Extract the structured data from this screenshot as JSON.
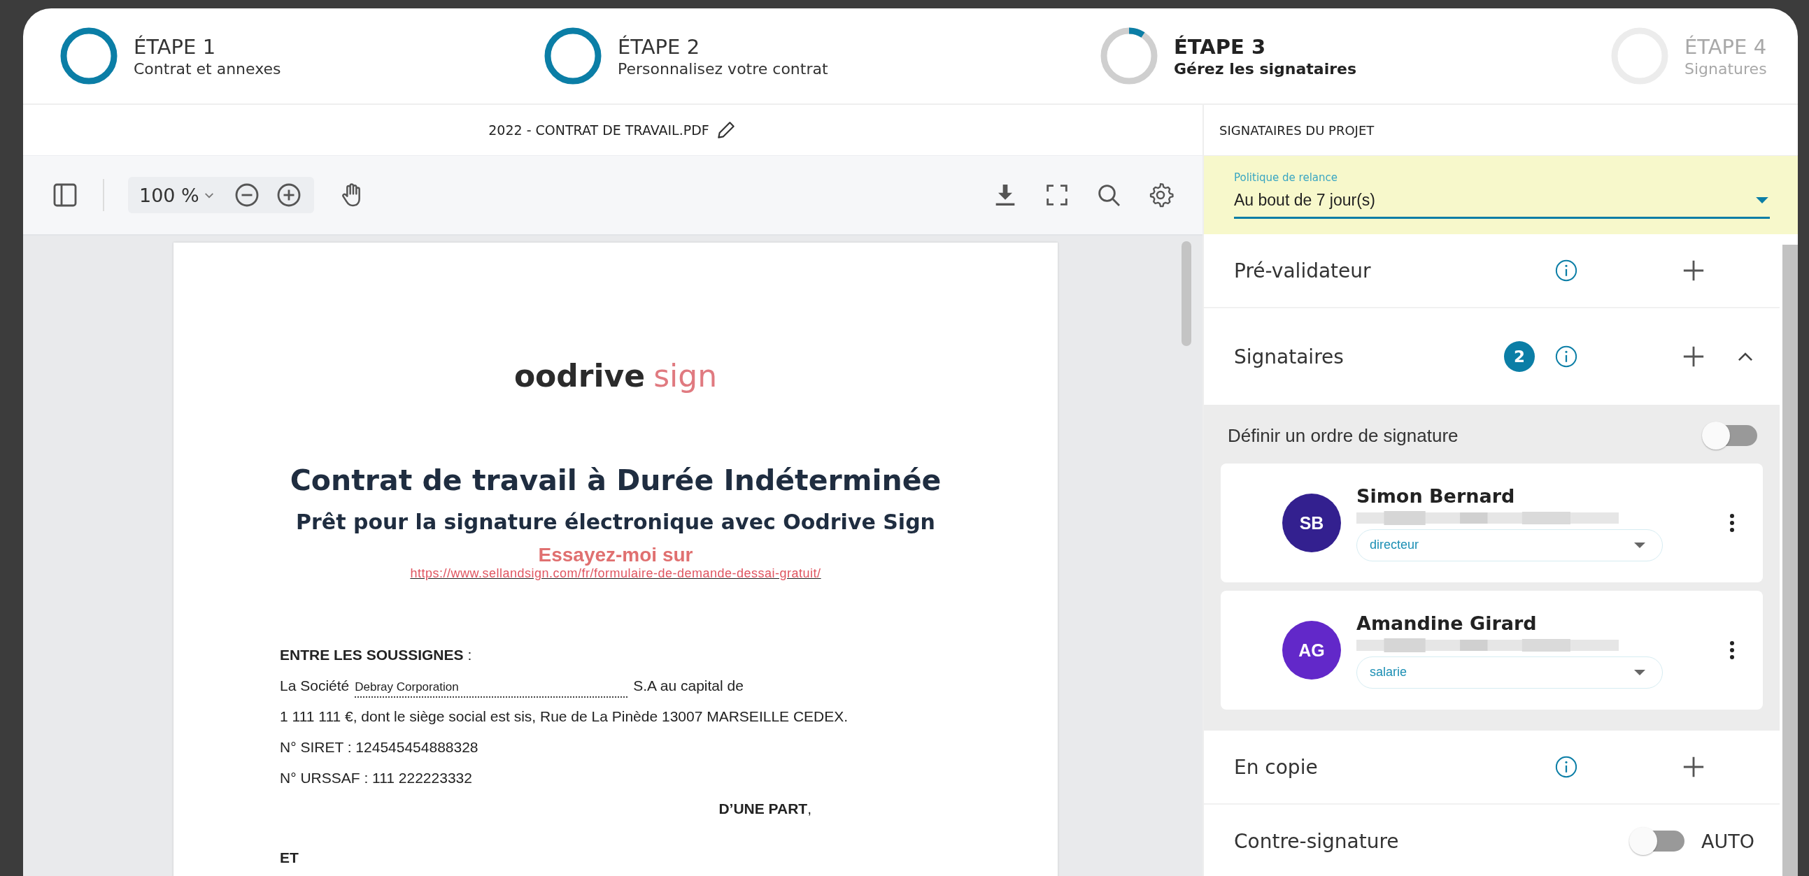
{
  "steps": [
    {
      "label": "ÉTAPE 1",
      "caption": "Contrat et annexes",
      "completed": true,
      "selected": false
    },
    {
      "label": "ÉTAPE 2",
      "caption": "Personnalisez votre contrat",
      "completed": true,
      "selected": false
    },
    {
      "label": "ÉTAPE 3",
      "caption": "Gérez les signataires",
      "completed": false,
      "selected": true
    },
    {
      "label": "ÉTAPE 4",
      "caption": "Signatures",
      "completed": false,
      "selected": false
    }
  ],
  "viewer": {
    "file_name": "2022 - CONTRAT DE TRAVAIL.PDF",
    "zoom": "100 %",
    "document": {
      "logo_main": "oodrive",
      "logo_accent": "sign",
      "title": "Contrat de travail à Durée Indéterminée",
      "subtitle": "Prêt pour la signature électronique avec Oodrive Sign",
      "cta": "Essayez-moi sur",
      "link": "https://www.sellandsign.com/fr/formulaire-de-demande-dessai-gratuit/",
      "parties_heading": "**ENTRE LES SOUSSIGNES** :",
      "company_prefix": "La Société",
      "company_value": "Debray Corporation",
      "company_suffix": "S.A au capital de",
      "address": "1 111 111 €, dont le siège social est sis, Rue de La Pinède 13007 MARSEILLE CEDEX.",
      "siret": "N° SIRET : 124545454888328",
      "urssaf": "N° URSSAF : 111 222223332",
      "party_end": "**D’UNE PART**,",
      "and": "ET"
    }
  },
  "panel": {
    "title": "SIGNATAIRES DU PROJET",
    "reminder": {
      "label": "Politique de relance",
      "value": "Au bout de 7 jour(s)"
    },
    "prevalidator": {
      "label": "Pré-validateur"
    },
    "signers": {
      "label": "Signataires",
      "count": "2",
      "expanded": true,
      "order": {
        "label": "Définir un ordre de signature",
        "on": false
      },
      "items": [
        {
          "initials": "SB",
          "name": "Simon Bernard",
          "role": "directeur",
          "color": "#33208f"
        },
        {
          "initials": "AG",
          "name": "Amandine Girard",
          "role": "salarie",
          "color": "#6228c9"
        }
      ]
    },
    "copy": {
      "label": "En copie"
    },
    "countersign": {
      "label": "Contre-signature",
      "toggle_label": "AUTO",
      "on": false
    }
  }
}
